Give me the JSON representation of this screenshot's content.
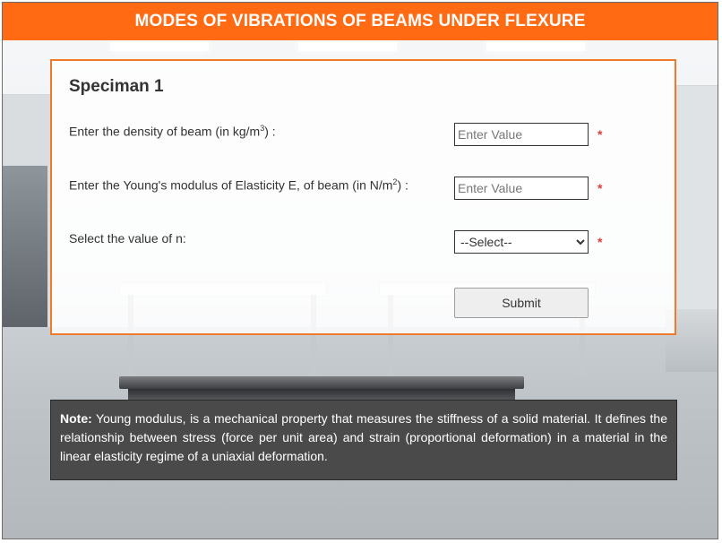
{
  "header": {
    "title": "MODES OF VIBRATIONS OF BEAMS UNDER FLEXURE"
  },
  "panel": {
    "title": "Speciman 1",
    "density": {
      "label_prefix": "Enter the density of beam (in kg/m",
      "label_sup": "3",
      "label_suffix": ") :",
      "placeholder": "Enter Value",
      "required_mark": "*"
    },
    "youngs": {
      "label_prefix": "Enter the Young's modulus of Elasticity E, of beam (in N/m",
      "label_sup": "2",
      "label_suffix": ") :",
      "placeholder": "Enter Value",
      "required_mark": "*"
    },
    "n_value": {
      "label": "Select the value of n:",
      "selected": "--Select--",
      "required_mark": "*"
    },
    "submit_label": "Submit"
  },
  "note": {
    "prefix": "Note:",
    "text": " Young modulus, is a mechanical property that measures the stiffness of a solid material. It defines the relationship between stress (force per unit area) and strain (proportional deformation) in a material in the linear elasticity regime of a uniaxial deformation."
  },
  "colors": {
    "header_bg": "#ff6a13",
    "panel_border": "#f07a2c",
    "required": "#e23b3b",
    "note_bg": "#4a4a4a"
  }
}
